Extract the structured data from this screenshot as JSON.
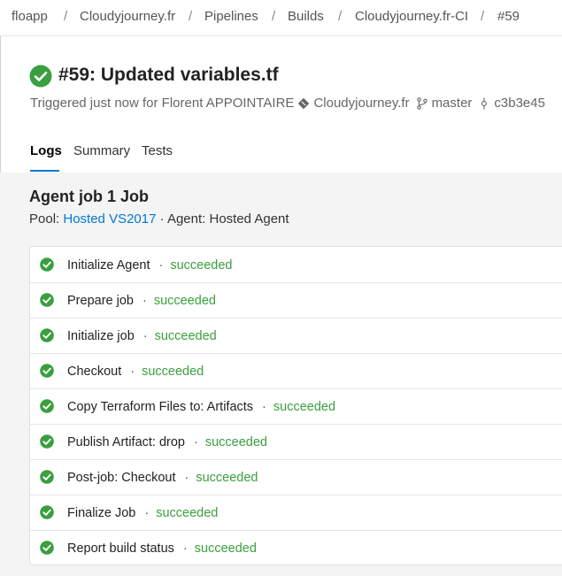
{
  "breadcrumb": {
    "items": [
      "floapp",
      "Cloudyjourney.fr",
      "Pipelines",
      "Builds",
      "Cloudyjourney.fr-CI",
      "#59"
    ],
    "separator": "/"
  },
  "build": {
    "number": "#59:",
    "title": "Updated variables.tf",
    "trigger_text": "Triggered just now for Florent APPOINTAIRE",
    "repo": "Cloudyjourney.fr",
    "branch": "master",
    "commit": "c3b3e45",
    "status_color": "#3a9f3f"
  },
  "tabs": [
    "Logs",
    "Summary",
    "Tests"
  ],
  "job": {
    "title": "Agent job 1 Job",
    "pool_label": "Pool:",
    "pool_value": "Hosted VS2017",
    "agent_text": "· Agent: Hosted Agent"
  },
  "steps": [
    {
      "name": "Initialize Agent",
      "status": "succeeded"
    },
    {
      "name": "Prepare job",
      "status": "succeeded"
    },
    {
      "name": "Initialize job",
      "status": "succeeded"
    },
    {
      "name": "Checkout",
      "status": "succeeded"
    },
    {
      "name": "Copy Terraform Files to: Artifacts",
      "status": "succeeded"
    },
    {
      "name": "Publish Artifact: drop",
      "status": "succeeded"
    },
    {
      "name": "Post-job: Checkout",
      "status": "succeeded"
    },
    {
      "name": "Finalize Job",
      "status": "succeeded"
    },
    {
      "name": "Report build status",
      "status": "succeeded"
    }
  ],
  "colors": {
    "accent": "#0078d4",
    "success": "#3a9f3f"
  }
}
